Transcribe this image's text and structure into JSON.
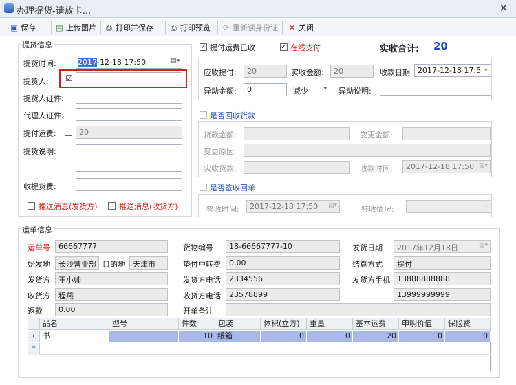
{
  "window": {
    "title": "办理提货-请放卡..."
  },
  "toolbar": {
    "save": "保存",
    "upload_image": "上传图片",
    "print_and_save": "打印并保存",
    "print_preview": "打印预览",
    "reread_id": "重新读身份证",
    "close": "关闭"
  },
  "pickup": {
    "group_title": "提货信息",
    "time_label": "提货时间:",
    "time_value_sel": "2017",
    "time_value_rest": "-12-18 17:50",
    "person_label": "提货人:",
    "person_checked": "☑",
    "person_value": "",
    "id_label": "提货人证件:",
    "agent_id_label": "代理人证件:",
    "freight_label": "提付运费:",
    "freight_value": "20",
    "note_label": "提货说明:",
    "fee_label": "收提货费:",
    "push_sender": "推送消息(发货方)",
    "push_receiver": "推送消息(收货方)"
  },
  "payment": {
    "freight_received": "提付运费已收",
    "online_pay": "在线支付",
    "total_label": "实收合计:",
    "total_value": "20",
    "receivable_label": "应收提付:",
    "receivable_value": "20",
    "actual_label": "实收金额:",
    "actual_value": "20",
    "date_label": "收款日期",
    "date_value": "2017-12-18 17:5",
    "change_amount_label": "异动金额:",
    "change_amount_value": "0",
    "change_type": "减少",
    "change_note_label": "异动说明:"
  },
  "cod": {
    "title": "是否回收货款",
    "amount_label": "货款金额:",
    "change_amount_label": "变更金额:",
    "change_reason_label": "变更原因:",
    "actual_label": "实收货款:",
    "time_label": "收款时间:",
    "time_value": "2017-12-18 17:50"
  },
  "receipt": {
    "title": "是否签收回单",
    "sign_time_label": "签收时间:",
    "sign_time_value": "2017-12-18 17:50",
    "sign_status_label": "签收情况:"
  },
  "waybill": {
    "group_title": "运单信息",
    "no_label": "运单号",
    "no_value": "66667777",
    "origin_label": "始发地",
    "origin_value": "长沙营业部",
    "dest_label": "目的地",
    "dest_value": "天津市",
    "sender_label": "发货方",
    "sender_value": "王小帅",
    "receiver_label": "收货方",
    "receiver_value": "程燕",
    "rebate_label": "返款",
    "rebate_value": "0.00",
    "goods_no_label": "货物编号",
    "goods_no_value": "18-66667777-10",
    "transfer_fee_label": "垫付中转费",
    "transfer_fee_value": "0.00",
    "sender_phone_label": "发货方电话",
    "sender_phone_value": "2334556",
    "receiver_phone_label": "收货方电话",
    "receiver_phone_value": "23578899",
    "remark_label": "开单备注",
    "ship_date_label": "发货日期",
    "ship_date_value": "2017年12月18日",
    "settle_label": "结算方式",
    "settle_value": "提付",
    "sender_mobile_label": "发货方手机",
    "sender_mobile_value": "13888888888",
    "receiver_mobile_value": "13999999999"
  },
  "grid": {
    "columns": [
      "品名",
      "型号",
      "件数",
      "包装",
      "体积(立方)",
      "重量",
      "基本运费",
      "申明价值",
      "保险费"
    ],
    "row": [
      "书",
      "",
      "10",
      "纸箱",
      "0",
      "0",
      "20",
      "0",
      "0"
    ],
    "new_row_marker": "*"
  },
  "colors": {
    "accent_red": "#d81e1e",
    "accent_blue": "#2a52be",
    "total_blue": "#1f4fcf"
  }
}
